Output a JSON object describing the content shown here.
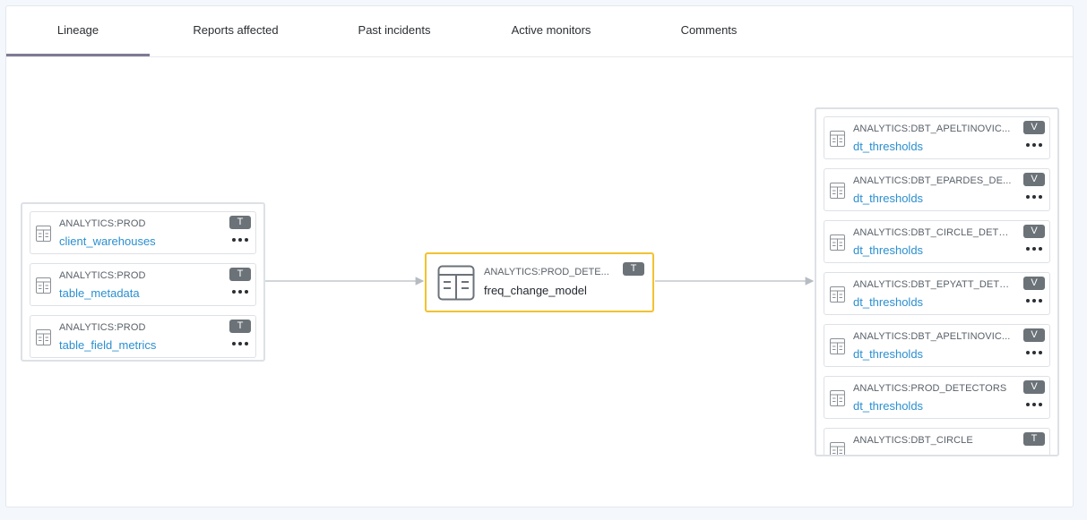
{
  "tabs": [
    {
      "label": "Lineage",
      "active": true
    },
    {
      "label": "Reports affected",
      "active": false
    },
    {
      "label": "Past incidents",
      "active": false
    },
    {
      "label": "Active monitors",
      "active": false
    },
    {
      "label": "Comments",
      "active": false
    }
  ],
  "upstream": [
    {
      "schema": "ANALYTICS:PROD",
      "name": "client_warehouses",
      "type": "T"
    },
    {
      "schema": "ANALYTICS:PROD",
      "name": "table_metadata",
      "type": "T"
    },
    {
      "schema": "ANALYTICS:PROD",
      "name": "table_field_metrics",
      "type": "T"
    }
  ],
  "focus": {
    "schema": "ANALYTICS:PROD_DETE...",
    "name": "freq_change_model",
    "type": "T"
  },
  "downstream": [
    {
      "schema": "ANALYTICS:DBT_APELTINOVIC...",
      "name": "dt_thresholds",
      "type": "V"
    },
    {
      "schema": "ANALYTICS:DBT_EPARDES_DE...",
      "name": "dt_thresholds",
      "type": "V"
    },
    {
      "schema": "ANALYTICS:DBT_CIRCLE_DETE...",
      "name": "dt_thresholds",
      "type": "V"
    },
    {
      "schema": "ANALYTICS:DBT_EPYATT_DETE...",
      "name": "dt_thresholds",
      "type": "V"
    },
    {
      "schema": "ANALYTICS:DBT_APELTINOVIC...",
      "name": "dt_thresholds",
      "type": "V"
    },
    {
      "schema": "ANALYTICS:PROD_DETECTORS",
      "name": "dt_thresholds",
      "type": "V"
    },
    {
      "schema": "ANALYTICS:DBT_CIRCLE",
      "name": "",
      "type": "T"
    }
  ],
  "icons": {
    "table": "table-icon",
    "more": "more-options-icon"
  },
  "colors": {
    "focus_border": "#f2c230",
    "link": "#2b8fd0",
    "active_tab": "#7f7a94",
    "badge": "#6b7278"
  }
}
